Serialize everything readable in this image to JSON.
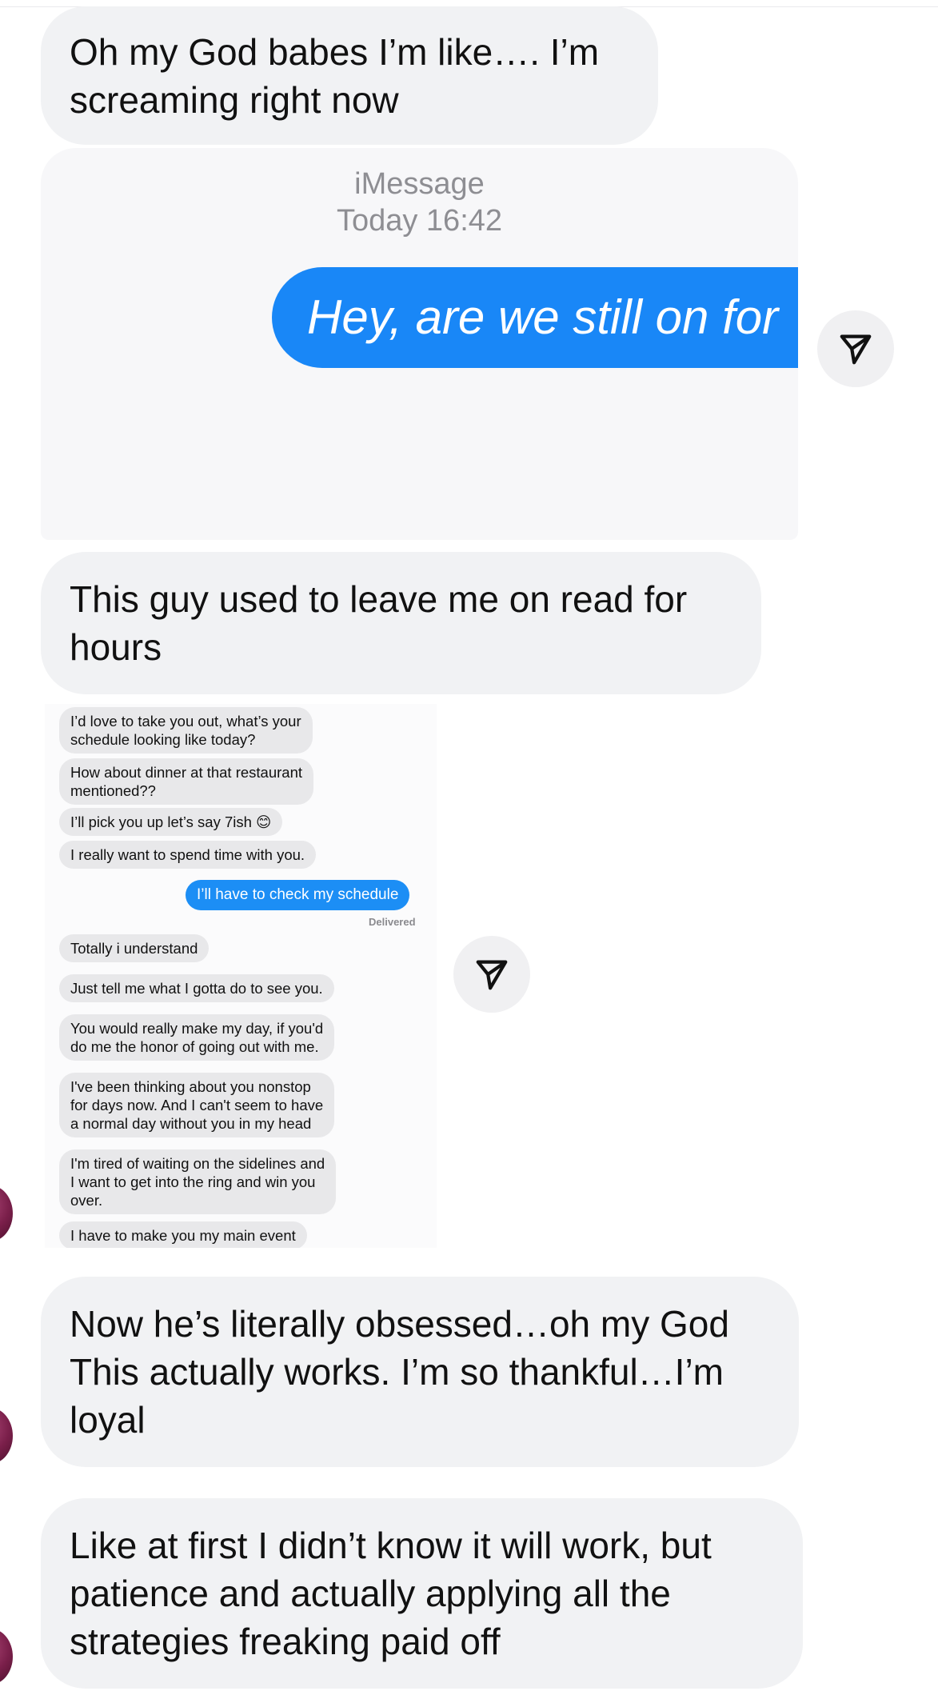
{
  "messages": {
    "m1": [
      "Oh my God babes I’m like…. I’m",
      "screaming right now"
    ],
    "m2": [
      "This guy used to leave me on read for",
      "hours"
    ],
    "m3": [
      "Now he’s literally obsessed…oh my God",
      "This actually works. I’m so thankful…I’m",
      "loyal"
    ],
    "m4": [
      "Like at first I didn’t know it will work, but",
      "patience and actually applying all the",
      "strategies freaking paid off"
    ]
  },
  "imessage_preview": {
    "service": "iMessage",
    "time": "Today 16:42",
    "sent_text": "Hey, are we still on for"
  },
  "chat_screenshot": {
    "incoming_1": [
      "I’d love to take you out, what’s your",
      "schedule looking like today?"
    ],
    "incoming_2": [
      "How about dinner at that restaurant",
      "mentioned??"
    ],
    "incoming_3": "I’ll pick you up let’s say 7ish 😊",
    "incoming_4": "I really want to spend time with you.",
    "outgoing_1": "I’ll have to check my schedule",
    "status": "Delivered",
    "incoming_5": "Totally i understand",
    "incoming_6": "Just tell me what I gotta do to see you.",
    "incoming_7": [
      "You would really make my day, if you'd",
      "do me the honor of going out with me."
    ],
    "incoming_8": [
      "I've been thinking about you nonstop",
      "for days now. And I can't seem to have",
      "a normal day without you in my head"
    ],
    "incoming_9": [
      "I'm tired of waiting on the sidelines and",
      "I want to get into the ring and win you",
      "over."
    ],
    "incoming_10": "I have to make you my main event"
  },
  "colors": {
    "bubble_gray": "#f1f2f4",
    "imessage_blue": "#1987f7",
    "share_button_bg": "#f0f0f2"
  },
  "icons": {
    "share": "paper-plane-icon",
    "avatar": "avatar"
  }
}
